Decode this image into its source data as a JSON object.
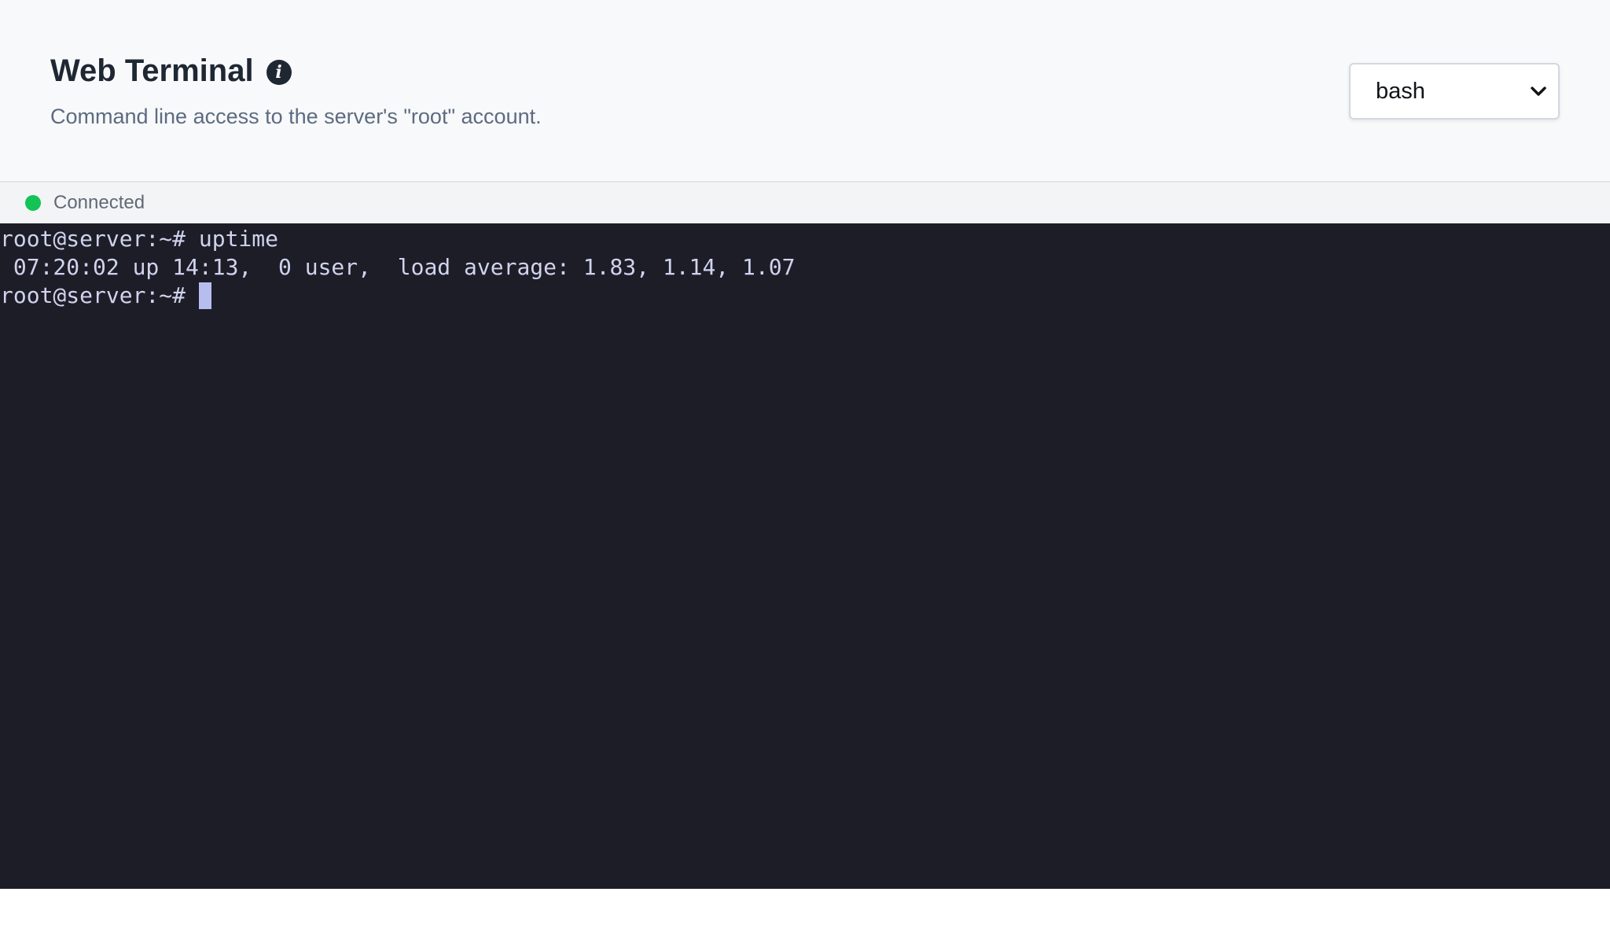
{
  "header": {
    "title": "Web Terminal",
    "info_icon": "info-icon",
    "subtitle": "Command line access to the server's \"root\" account."
  },
  "shell_select": {
    "selected": "bash",
    "icon": "chevron-down-icon"
  },
  "status": {
    "text": "Connected",
    "color": "#13c356"
  },
  "terminal": {
    "background": "#1d1d28",
    "lines": [
      "root@server:~# uptime",
      " 07:20:02 up 14:13,  0 user,  load average: 1.83, 1.14, 1.07",
      "root@server:~# "
    ]
  }
}
